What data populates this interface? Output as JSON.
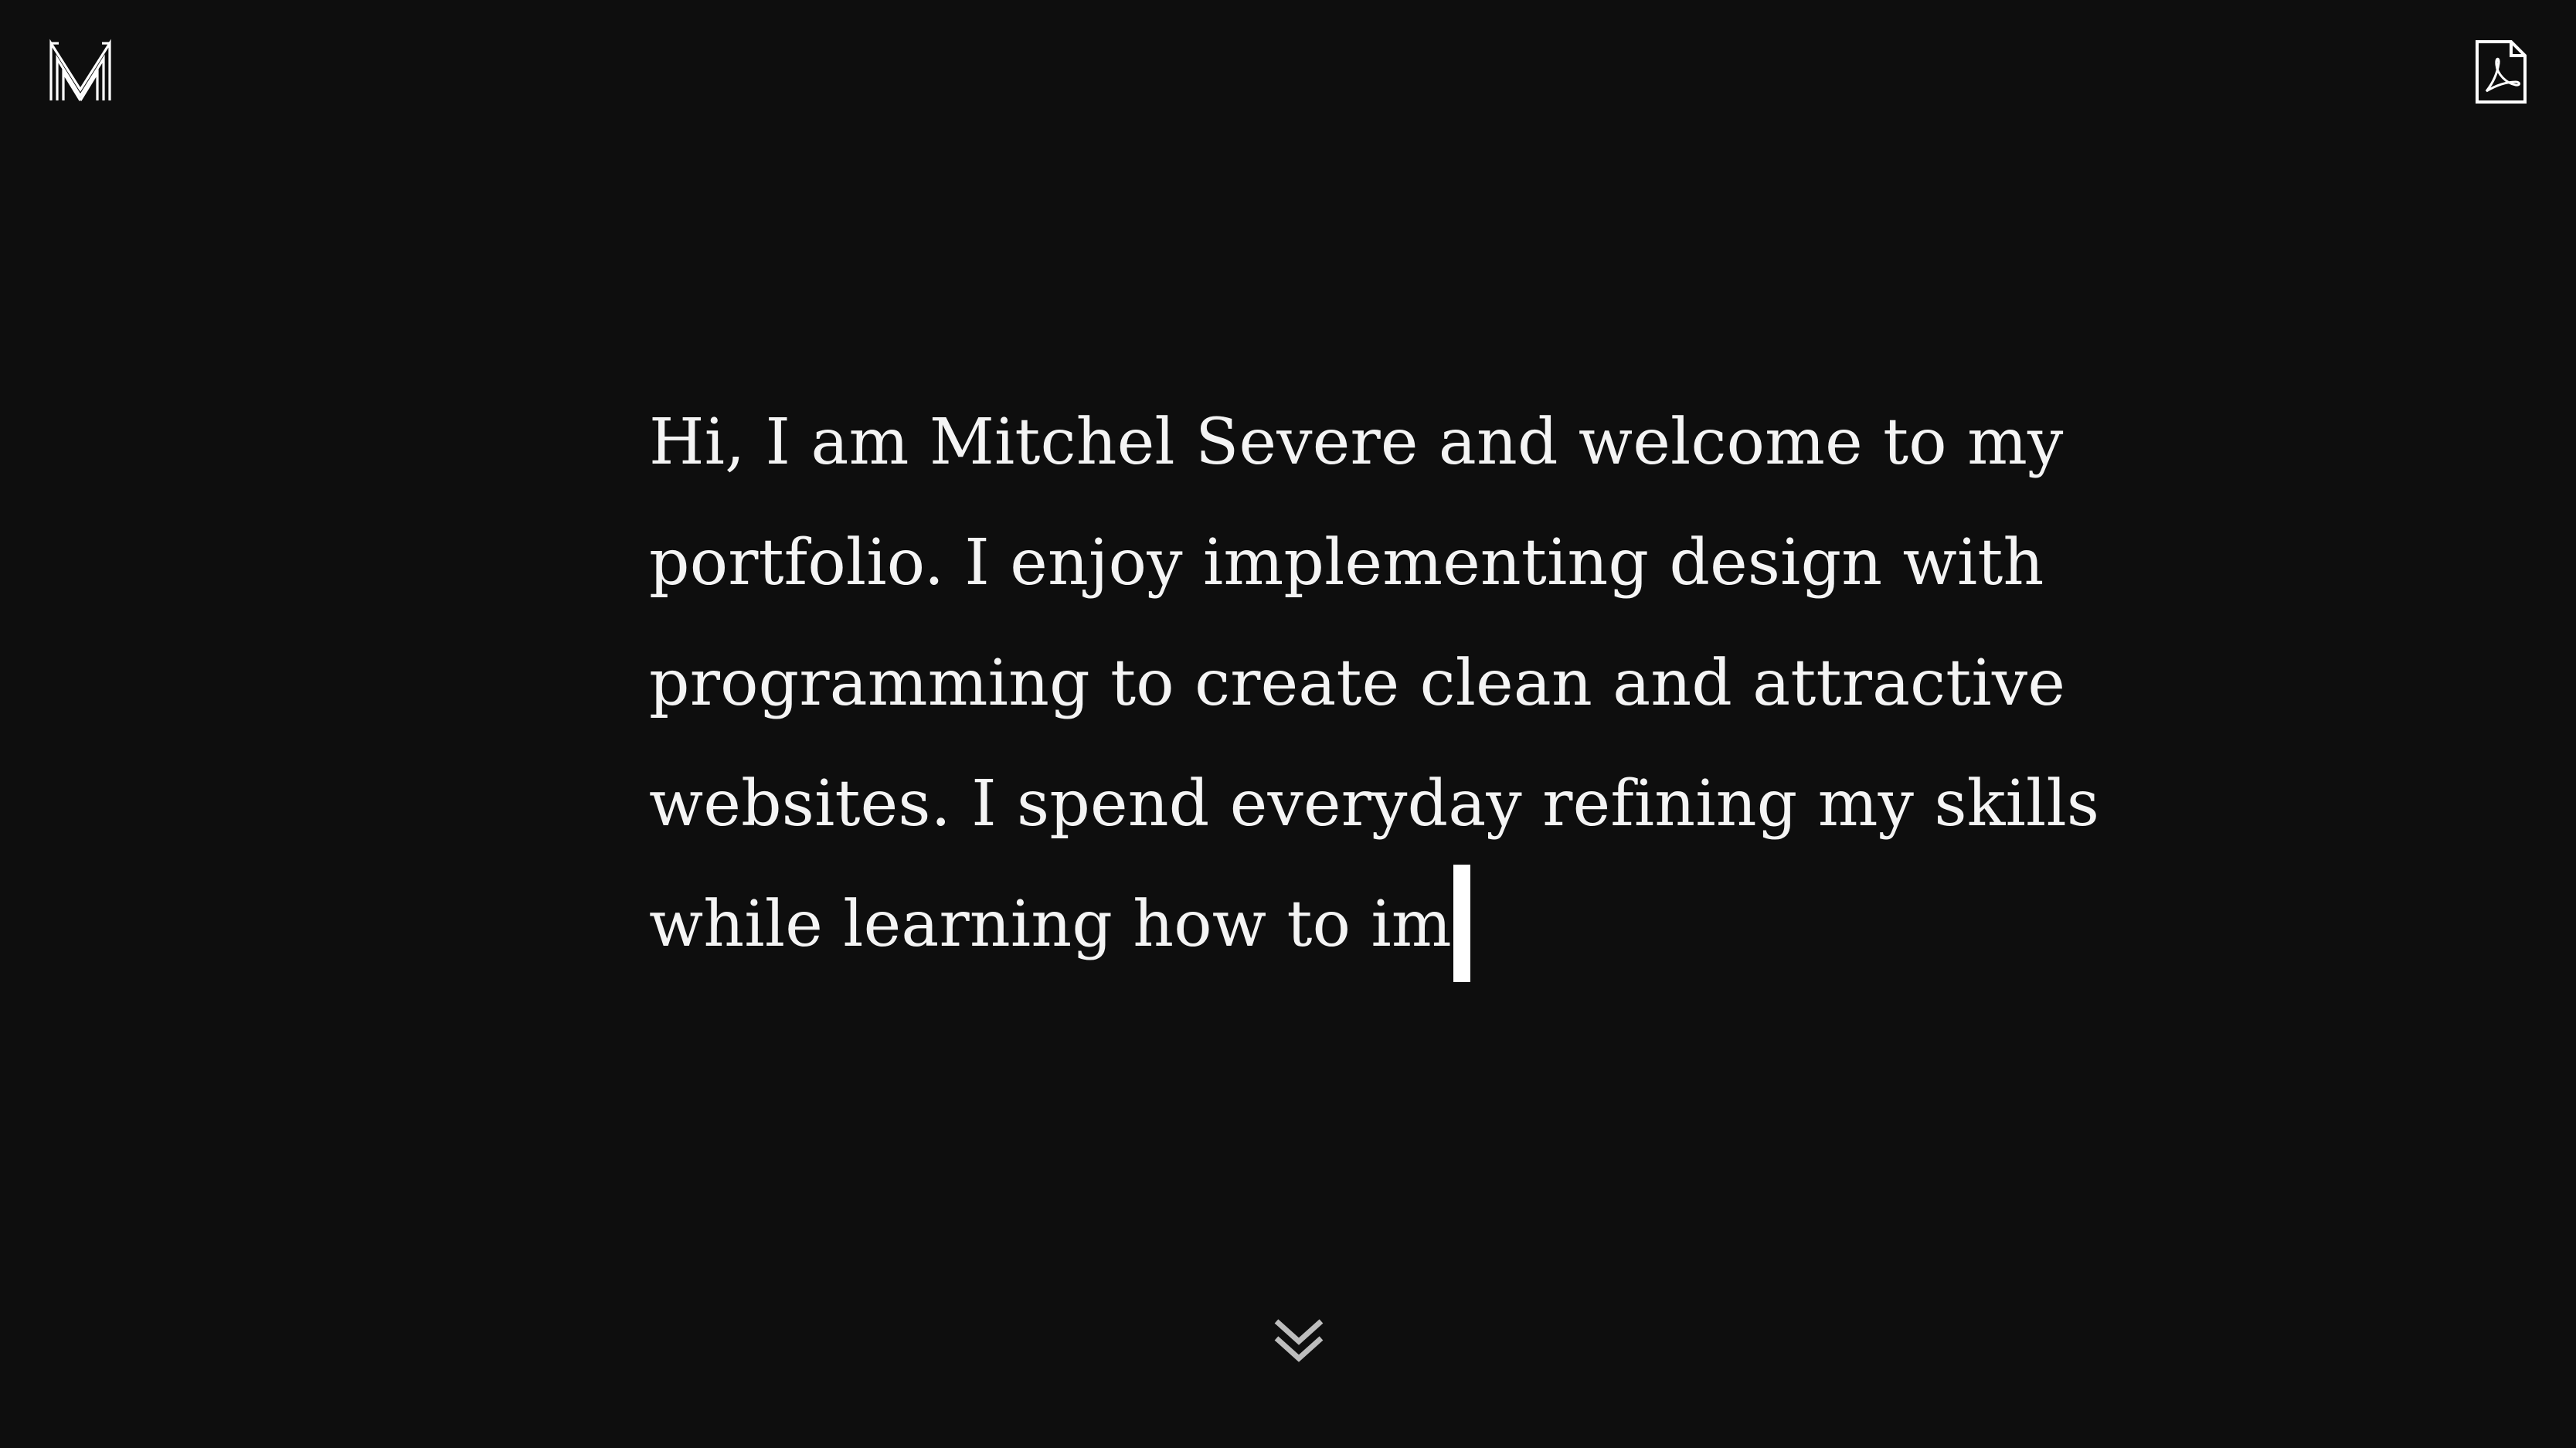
{
  "header": {
    "logo_icon": "m-monogram-logo-icon",
    "resume_icon": "pdf-file-icon"
  },
  "intro": {
    "lines": [
      "Hi, I am Mitchel Severe and welcome to my",
      "portfolio. I enjoy implementing design with",
      "programming to create clean and attractive",
      "websites. I spend everyday refining my skills",
      "while learning how to im"
    ]
  },
  "footer": {
    "scroll_icon": "double-chevron-down-icon"
  },
  "colors": {
    "background": "#0e0e0e",
    "text": "#f4f4f4",
    "caret": "#ffffff",
    "chevron": "#bdbdbd"
  }
}
